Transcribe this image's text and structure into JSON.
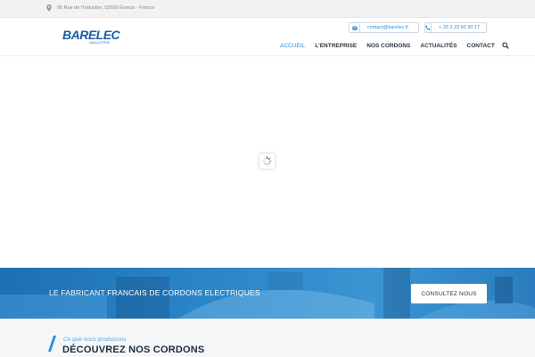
{
  "topbar": {
    "address": "90 Rue de l'Industrie, 02600 Évreux - France"
  },
  "header": {
    "logo_text": "BARELEC",
    "logo_subtext": "INDUSTRIE",
    "email": "contact@barelec.fr",
    "phone": "+ 33 3 23 60 30 17"
  },
  "nav": {
    "items": [
      {
        "label": "ACCUEIL",
        "active": true
      },
      {
        "label": "L'ENTREPRISE",
        "active": false
      },
      {
        "label": "NOS CORDONS",
        "active": false
      },
      {
        "label": "ACTUALITÉS",
        "active": false
      },
      {
        "label": "CONTACT",
        "active": false
      }
    ],
    "search_icon": "search-icon"
  },
  "banner": {
    "text": "LE FABRICANT FRANCAIS DE CORDONS ELECTRIQUES",
    "button": "CONSULTEZ NOUS"
  },
  "section": {
    "subtitle": "Ce que nous produisons",
    "title": "DÉCOUVREZ NOS CORDONS"
  },
  "colors": {
    "accent": "#2f8fd6",
    "brand": "#1a5ea8",
    "banner": "#2b86c8",
    "dark": "#1d2b3a"
  }
}
